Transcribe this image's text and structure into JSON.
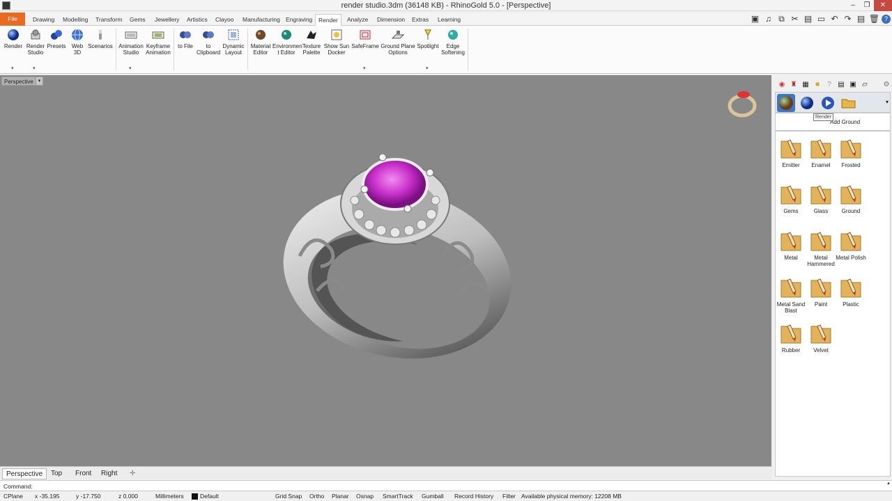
{
  "window": {
    "title": "render studio.3dm (36148 KB) - RhinoGold 5.0 - [Perspective]",
    "controls": [
      "minimize",
      "restore",
      "close"
    ]
  },
  "menu": {
    "tabs": [
      "File",
      "Drawing",
      "Modelling",
      "Transform",
      "Gems",
      "Jewellery",
      "Artistics",
      "Clayoo",
      "Manufacturing",
      "Engraving",
      "Render",
      "Analyze",
      "Dimension",
      "Extras",
      "Learning"
    ],
    "active": "Render"
  },
  "ribbon": {
    "render": "Render",
    "render_studio": [
      "Render",
      "Studio"
    ],
    "presets": "Presets",
    "web3d": [
      "Web",
      "3D"
    ],
    "scenarios": "Scenarios",
    "animation_studio": [
      "Animation",
      "Studio"
    ],
    "keyframe_animation": [
      "Keyframe",
      "Animation"
    ],
    "to_file": "to File",
    "to_clipboard": [
      "to",
      "Clipboard"
    ],
    "dynamic_layout": [
      "Dynamic",
      "Layout"
    ],
    "material_editor": [
      "Material",
      "Editor"
    ],
    "environment_editor": [
      "Environmen",
      "t Editor"
    ],
    "texture_palette": [
      "Texture",
      "Palette"
    ],
    "show_sun_docker": [
      "Show Sun",
      "Docker"
    ],
    "safeframe": "SafeFrame",
    "ground_plane_options": [
      "Ground Plane",
      "Options"
    ],
    "spotlight": "Spotlight",
    "edge_softening": [
      "Edge",
      "Softening"
    ]
  },
  "viewport": {
    "label": "Perspective",
    "background": "#888888",
    "gem_color": "#c72ec9"
  },
  "panel": {
    "tooltip": "Render",
    "add_ground": "Add Ground",
    "materials": [
      "Emitter",
      "Enamel",
      "Frosted",
      "Gems",
      "Glass",
      "Ground",
      "Metal",
      "Metal Hammered",
      "Metal Polish",
      "Metal Sand Blast",
      "Paint",
      "Plastic",
      "Rubber",
      "Velvet"
    ]
  },
  "viewport_tabs": [
    "Perspective",
    "Top",
    "Front",
    "Right"
  ],
  "command": {
    "label": "Command:",
    "value": ""
  },
  "status": {
    "cplane": "CPlane",
    "x": "x -35.195",
    "y": "y -17.750",
    "z": "z 0.000",
    "units": "Millimeters",
    "layer": "Default",
    "grid_snap": "Grid Snap",
    "ortho": "Ortho",
    "planar": "Planar",
    "osnap": "Osnap",
    "smarttrack": "SmartTrack",
    "gumball": "Gumball",
    "record_history": "Record History",
    "filter": "Filter",
    "memory": "Available physical memory: 12208 MB"
  }
}
